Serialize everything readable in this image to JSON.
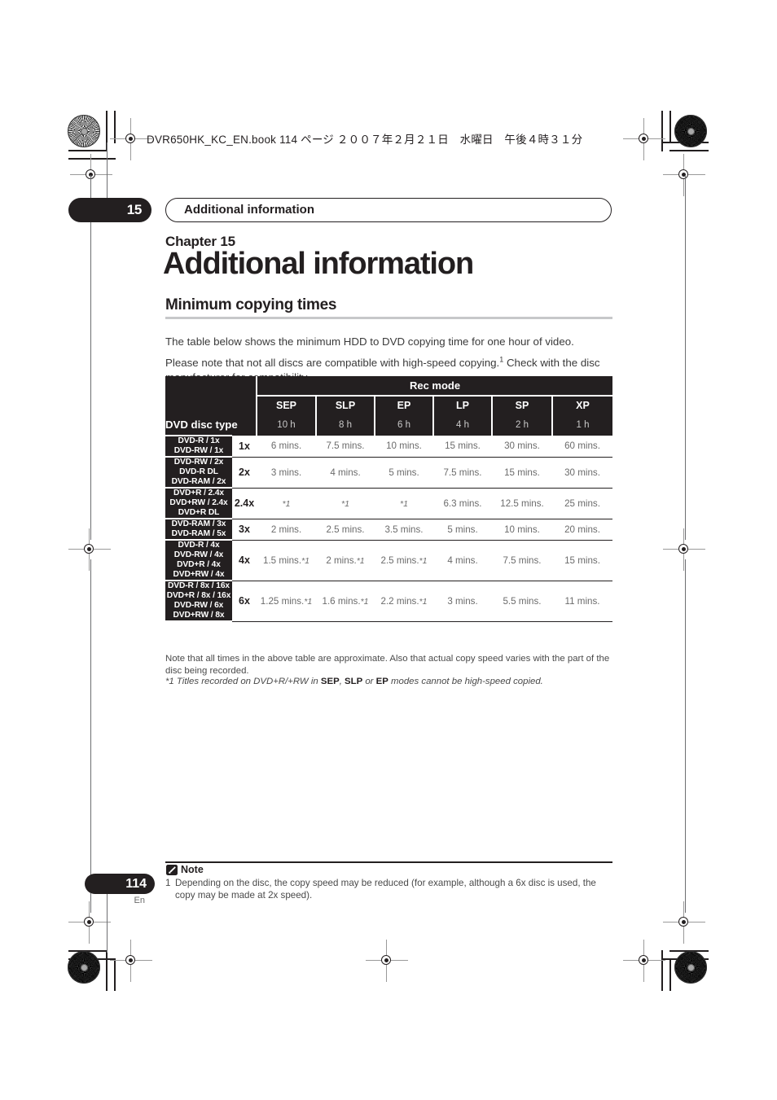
{
  "running_head": "DVR650HK_KC_EN.book  114 ページ  ２００７年２月２１日　水曜日　午後４時３１分",
  "chapter_tab": {
    "number": "15",
    "title": "Additional information"
  },
  "heading": {
    "chapter_label": "Chapter 15",
    "chapter_title": "Additional information"
  },
  "section": {
    "title": "Minimum copying times",
    "paragraph_1": "The table below shows the minimum HDD to DVD copying time for one hour of video.",
    "paragraph_2_before": "Please note that not all discs are compatible with high-speed copying.",
    "paragraph_2_sup": "1",
    "paragraph_2_after": " Check with the disc manufacturer for compatibility."
  },
  "table": {
    "group_header": "Rec mode",
    "disc_type_header": "DVD disc type",
    "mode_columns": [
      "SEP",
      "SLP",
      "EP",
      "LP",
      "SP",
      "XP"
    ],
    "mode_hours": [
      "10 h",
      "8 h",
      "6 h",
      "4 h",
      "2 h",
      "1 h"
    ],
    "rows": [
      {
        "disc_types": [
          "DVD-R / 1x",
          "DVD-RW / 1x"
        ],
        "speed": "1x",
        "values": [
          "6 mins.",
          "7.5 mins.",
          "10 mins.",
          "15 mins.",
          "30 mins.",
          "60 mins."
        ]
      },
      {
        "disc_types": [
          "DVD-RW / 2x",
          "DVD-R DL",
          "DVD-RAM / 2x"
        ],
        "speed": "2x",
        "values": [
          "3 mins.",
          "4 mins.",
          "5 mins.",
          "7.5 mins.",
          "15 mins.",
          "30 mins."
        ]
      },
      {
        "disc_types": [
          "DVD+R / 2.4x",
          "DVD+RW / 2.4x",
          "DVD+R DL"
        ],
        "speed": "2.4x",
        "values": [
          "*1",
          "*1",
          "*1",
          "6.3 mins.",
          "12.5 mins.",
          "25 mins."
        ]
      },
      {
        "disc_types": [
          "DVD-RAM / 3x",
          "DVD-RAM / 5x"
        ],
        "speed": "3x",
        "values": [
          "2 mins.",
          "2.5 mins.",
          "3.5 mins.",
          "5 mins.",
          "10 mins.",
          "20 mins."
        ]
      },
      {
        "disc_types": [
          "DVD-R / 4x",
          "DVD-RW / 4x",
          "DVD+R / 4x",
          "DVD+RW / 4x"
        ],
        "speed": "4x",
        "values": [
          "1.5 mins.*1",
          "2 mins.*1",
          "2.5 mins.*1",
          "4 mins.",
          "7.5 mins.",
          "15 mins."
        ]
      },
      {
        "disc_types": [
          "DVD-R / 8x / 16x",
          "DVD+R / 8x / 16x",
          "DVD-RW / 6x",
          "DVD+RW / 8x"
        ],
        "speed": "6x",
        "values": [
          "1.25 mins.*1",
          "1.6 mins.*1",
          "2.2 mins.*1",
          "3 mins.",
          "5.5 mins.",
          "11 mins."
        ]
      }
    ]
  },
  "table_notes": {
    "note_1": "Note that all times in the above table are approximate. Also that actual copy speed varies with the part of the disc being recorded.",
    "note_2_pre": "*1 Titles recorded on DVD+R/+RW in ",
    "note_2_b1": "SEP",
    "note_2_mid1": ", ",
    "note_2_b2": "SLP",
    "note_2_mid2": " or ",
    "note_2_b3": "EP",
    "note_2_post": " modes cannot be high-speed copied."
  },
  "bottom_note": {
    "label": "Note",
    "icon": "note-pencil-icon",
    "item_number": "1",
    "item_text": "Depending on the disc, the copy speed may be reduced (for example, although a 6x disc is used, the copy may be made at 2x speed)."
  },
  "footer": {
    "page_number": "114",
    "language": "En"
  },
  "colors": {
    "ink": "#231f20",
    "rule": "#c7c8ca",
    "body_text": "#3a3a3a",
    "muted": "#6b6b6b"
  }
}
